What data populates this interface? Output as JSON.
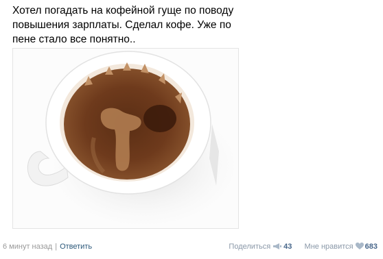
{
  "post": {
    "text": "Хотел погадать на кофейной гуще по поводу повышения зарплаты. Сделал кофе. Уже по пене стало все понятно.."
  },
  "footer": {
    "time": "6 минут назад",
    "separator": "|",
    "reply_label": "Ответить",
    "share_label": "Поделиться",
    "share_icon": "megaphone-icon",
    "share_count": "43",
    "like_label": "Мне нравится",
    "like_icon": "heart-icon",
    "like_count": "683"
  },
  "colors": {
    "link": "#2b587a",
    "muted": "#999999",
    "count": "#47668a",
    "coffee": "#7a4a25",
    "foam": "#b5865a"
  }
}
